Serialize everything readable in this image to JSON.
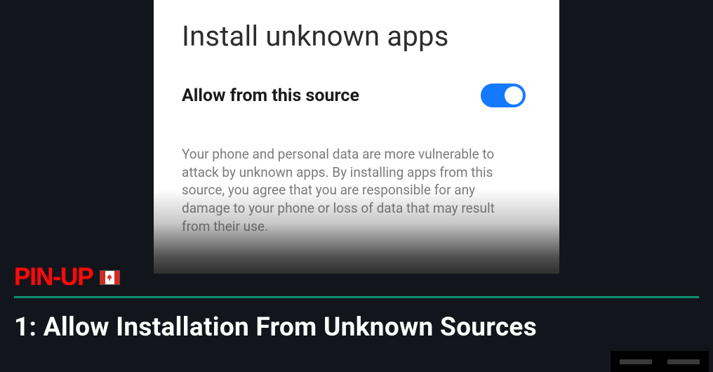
{
  "screenshot": {
    "title": "Install unknown apps",
    "allow_label": "Allow from this source",
    "warning": "Your phone and personal data are more vulnerable to attack by unknown apps. By installing apps from this source, you agree that you are responsible for any damage to your phone or loss of data that may result from their use."
  },
  "brand": {
    "logo": "PIN-UP"
  },
  "step_title": "1: Allow Installation From Unknown Sources"
}
